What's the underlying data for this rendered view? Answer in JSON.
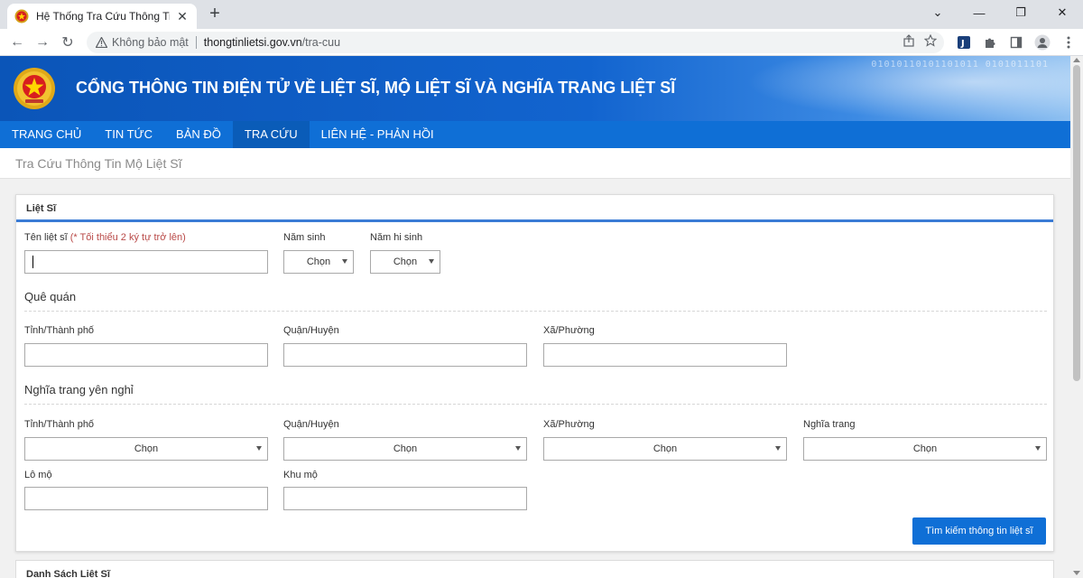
{
  "browser": {
    "tab_title": "Hệ Thống Tra Cứu Thông Tin Mộ",
    "tab_close": "✕",
    "new_tab": "+",
    "window_controls": [
      "⌄",
      "—",
      "❐",
      "✕"
    ],
    "nav": {
      "back": "←",
      "forward": "→",
      "reload": "↻"
    },
    "security_label": "Không bảo mật",
    "url_host": "thongtinlietsi.gov.vn",
    "url_path": "/tra-cuu",
    "extension_icons": [
      "share-icon",
      "bookmark-star-icon",
      "extension-j-icon",
      "puzzle-icon",
      "sidepanel-icon",
      "profile-icon",
      "menu-icon"
    ]
  },
  "site": {
    "title": "CỔNG THÔNG TIN ĐIỆN TỬ VỀ LIỆT SĨ, MỘ LIỆT SĨ VÀ NGHĨA TRANG LIỆT SĨ",
    "header_binary": "01010110101101011 0101011101",
    "nav": [
      "TRANG CHỦ",
      "TIN TỨC",
      "BẢN ĐỒ",
      "TRA CỨU",
      "LIÊN HỆ - PHẢN HỒI"
    ],
    "active_nav": "TRA CỨU",
    "breadcrumb": "Tra Cứu Thông Tin Mộ Liệt Sĩ"
  },
  "form": {
    "panel_title": "Liệt Sĩ",
    "name_label": "Tên liệt sĩ",
    "name_hint": "(* Tối thiểu 2 ký tự trở lên)",
    "name_value": "",
    "birth_year_label": "Năm sinh",
    "death_year_label": "Năm hi sinh",
    "select_default": "Chọn",
    "hometown_section": "Quê quán",
    "cemetery_section": "Nghĩa trang yên nghỉ",
    "province_label": "Tỉnh/Thành phố",
    "district_label": "Quận/Huyện",
    "ward_label": "Xã/Phường",
    "cemetery_label": "Nghĩa trang",
    "plot_label": "Lô mộ",
    "area_label": "Khu mộ",
    "search_button": "Tìm kiếm thông tin liệt sĩ"
  },
  "results_title": "Danh Sách Liệt Sĩ",
  "colors": {
    "header_blue": "#0b55b8",
    "nav_blue": "#0f6fd6",
    "accent_blue": "#3a7bd5",
    "hint_red": "#b94a48"
  }
}
